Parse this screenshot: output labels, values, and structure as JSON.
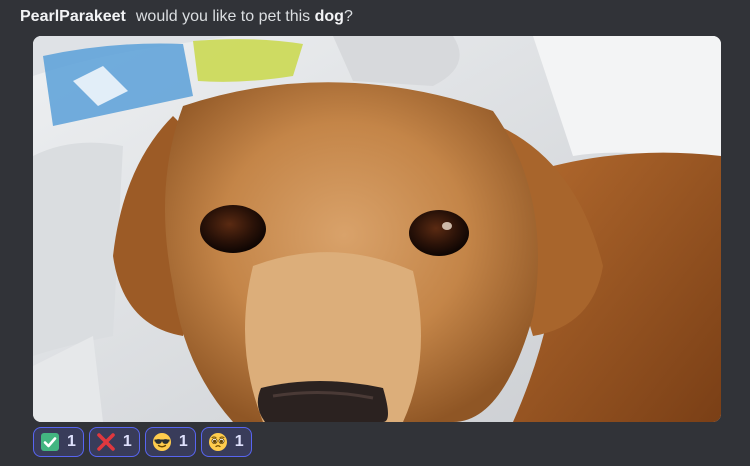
{
  "message": {
    "author": "PearlParakeet",
    "text_before": "would you like to pet this ",
    "text_bold": "dog",
    "text_after": "?"
  },
  "attachment": {
    "icon": "dog-photo"
  },
  "reactions": [
    {
      "emoji": "white-check-mark",
      "count": "1"
    },
    {
      "emoji": "x-cross-mark",
      "count": "1"
    },
    {
      "emoji": "smiling-face-with-sunglasses",
      "count": "1"
    },
    {
      "emoji": "pleading-face",
      "count": "1"
    }
  ],
  "colors": {
    "background": "#313338",
    "reaction_bg": "#393c5a",
    "reaction_border": "#5865f2",
    "fur": "#c98a4e"
  }
}
